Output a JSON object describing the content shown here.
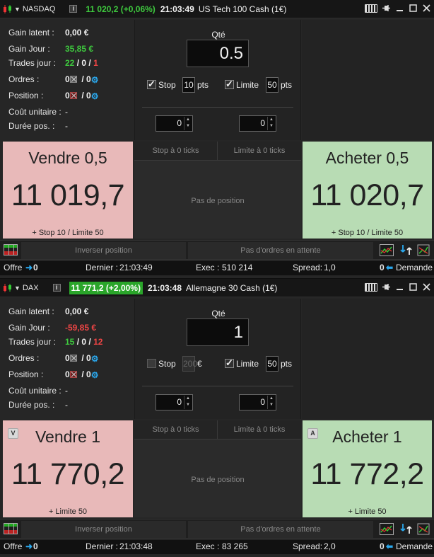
{
  "panels": [
    {
      "symbol": "NASDAQ",
      "price_change": "11 020,2 (+0,06%)",
      "price_boxed": false,
      "time": "21:03:49",
      "instrument": "US Tech 100 Cash (1€)",
      "stats": {
        "gain_latent_label": "Gain latent :",
        "gain_latent": "0,00 €",
        "gain_jour_label": "Gain Jour :",
        "gain_jour": "35,85 €",
        "gain_jour_color": "#3ec93e",
        "trades_label": "Trades jour :",
        "trades_win": "22",
        "trades_even": "0",
        "trades_loss": "1",
        "sep": "/",
        "ordres_label": "Ordres :",
        "ordres_a": "0",
        "ordres_b": "0",
        "position_label": "Position :",
        "position_a": "0",
        "position_b": "0",
        "cout_label": "Coût unitaire :",
        "cout": "-",
        "duree_label": "Durée pos. :",
        "duree": "-"
      },
      "order": {
        "qty_label": "Qté",
        "qty": "0.5",
        "stop_label": "Stop",
        "stop_checked": true,
        "stop_value": "10",
        "stop_unit": "pts",
        "stop_disabled": false,
        "limit_label": "Limite",
        "limit_checked": true,
        "limit_value": "50",
        "limit_unit": "pts",
        "stepper_left": "0",
        "stepper_right": "0"
      },
      "sell": {
        "title": "Vendre 0,5",
        "price": "11 019,7",
        "sub": "+ Stop 10 / Limite 50",
        "badge": ""
      },
      "buy": {
        "title": "Acheter 0,5",
        "price": "11 020,7",
        "sub": "+ Stop 10 / Limite 50",
        "badge": ""
      },
      "mid": {
        "tab_stop": "Stop à 0 ticks",
        "tab_limit": "Limite à 0 ticks",
        "message": "Pas de position"
      },
      "actions": {
        "reverse": "Inverser position",
        "pending": "Pas d'ordres en attente"
      },
      "footer": {
        "offre_label": "Offre",
        "offre": "0",
        "dernier_label": "Dernier :",
        "dernier": "21:03:49",
        "exec_label": "Exec :",
        "exec": "510 214",
        "spread_label": "Spread:",
        "spread": "1,0",
        "demande": "0",
        "demande_label": "Demande"
      }
    },
    {
      "symbol": "DAX",
      "price_change": "11 771,2 (+2,00%)",
      "price_boxed": true,
      "time": "21:03:48",
      "instrument": "Allemagne 30 Cash (1€)",
      "stats": {
        "gain_latent_label": "Gain latent :",
        "gain_latent": "0,00 €",
        "gain_jour_label": "Gain Jour :",
        "gain_jour": "-59,85 €",
        "gain_jour_color": "#ef4545",
        "trades_label": "Trades jour :",
        "trades_win": "15",
        "trades_even": "0",
        "trades_loss": "12",
        "sep": "/",
        "ordres_label": "Ordres :",
        "ordres_a": "0",
        "ordres_b": "0",
        "position_label": "Position :",
        "position_a": "0",
        "position_b": "0",
        "cout_label": "Coût unitaire :",
        "cout": "-",
        "duree_label": "Durée pos. :",
        "duree": "-"
      },
      "order": {
        "qty_label": "Qté",
        "qty": "1",
        "stop_label": "Stop",
        "stop_checked": false,
        "stop_value": "200",
        "stop_unit": "€",
        "stop_disabled": true,
        "limit_label": "Limite",
        "limit_checked": true,
        "limit_value": "50",
        "limit_unit": "pts",
        "stepper_left": "0",
        "stepper_right": "0"
      },
      "sell": {
        "title": "Vendre 1",
        "price": "11 770,2",
        "sub": "+ Limite 50",
        "badge": "V"
      },
      "buy": {
        "title": "Acheter 1",
        "price": "11 772,2",
        "sub": "+ Limite 50",
        "badge": "A"
      },
      "mid": {
        "tab_stop": "Stop à 0 ticks",
        "tab_limit": "Limite à 0 ticks",
        "message": "Pas de position"
      },
      "actions": {
        "reverse": "Inverser position",
        "pending": "Pas d'ordres en attente"
      },
      "footer": {
        "offre_label": "Offre",
        "offre": "0",
        "dernier_label": "Dernier :",
        "dernier": "21:03:48",
        "exec_label": "Exec :",
        "exec": "83 265",
        "spread_label": "Spread:",
        "spread": "2,0",
        "demande": "0",
        "demande_label": "Demande"
      }
    }
  ]
}
